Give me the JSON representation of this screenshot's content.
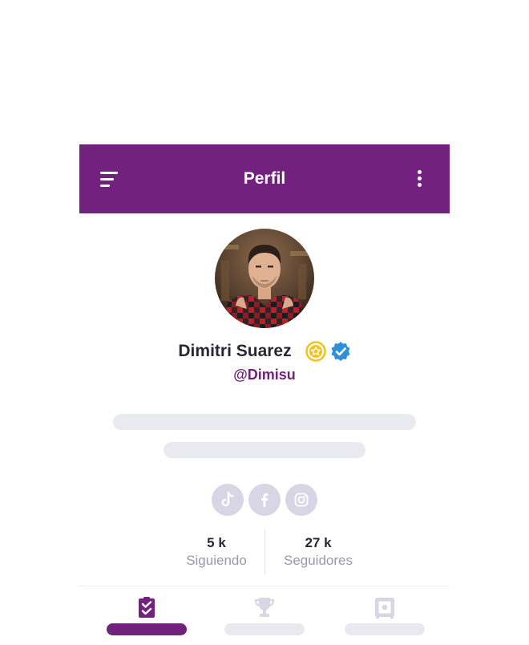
{
  "header": {
    "title": "Perfil",
    "color": "#73217f"
  },
  "profile": {
    "name": "Dimitri Suarez",
    "handle": "@Dimisu",
    "badges": [
      "star-badge-icon",
      "verified-badge-icon"
    ]
  },
  "socials": [
    {
      "icon": "tiktok-icon"
    },
    {
      "icon": "facebook-icon"
    },
    {
      "icon": "instagram-icon"
    }
  ],
  "stats": {
    "following": {
      "value": "5 k",
      "label": "Siguiendo"
    },
    "followers": {
      "value": "27 k",
      "label": "Seguidores"
    }
  },
  "tabs": [
    {
      "icon": "checklist-icon",
      "active": true
    },
    {
      "icon": "trophy-icon",
      "active": false
    },
    {
      "icon": "safe-icon",
      "active": false
    }
  ],
  "colors": {
    "accent": "#73217f",
    "skeleton": "#e9e9f0",
    "social_bg": "#d8d6e5",
    "verified": "#2f8fd8",
    "star": "#f2c21c"
  }
}
